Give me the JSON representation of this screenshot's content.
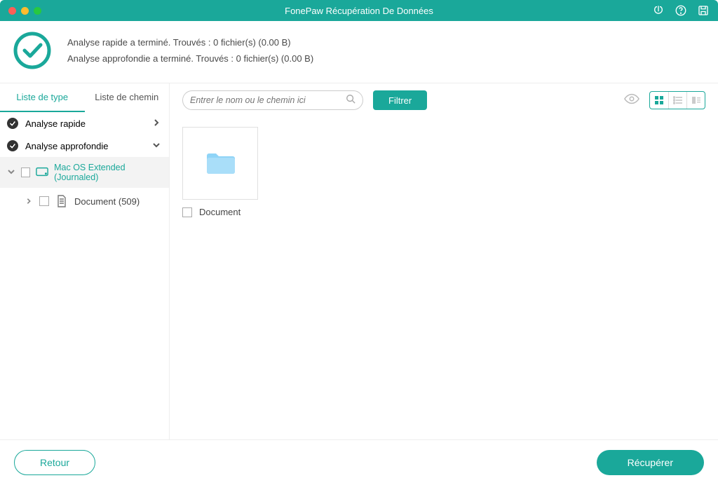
{
  "title": "FonePaw Récupération De Données",
  "status": {
    "line1": "Analyse rapide a terminé. Trouvés : 0 fichier(s) (0.00  B)",
    "line2": "Analyse approfondie a terminé. Trouvés : 0 fichier(s) (0.00  B)"
  },
  "tabs": {
    "type": "Liste de type",
    "path": "Liste de chemin"
  },
  "tree": {
    "quick": "Analyse rapide",
    "deep": "Analyse approfondie",
    "drive": "Mac OS Extended (Journaled)",
    "doc": "Document (509)"
  },
  "search": {
    "placeholder": "Entrer le nom ou le chemin ici"
  },
  "filter_label": "Filtrer",
  "file": {
    "name": "Document"
  },
  "footer": {
    "back": "Retour",
    "recover": "Récupérer"
  },
  "colors": {
    "accent": "#1aa89a"
  }
}
